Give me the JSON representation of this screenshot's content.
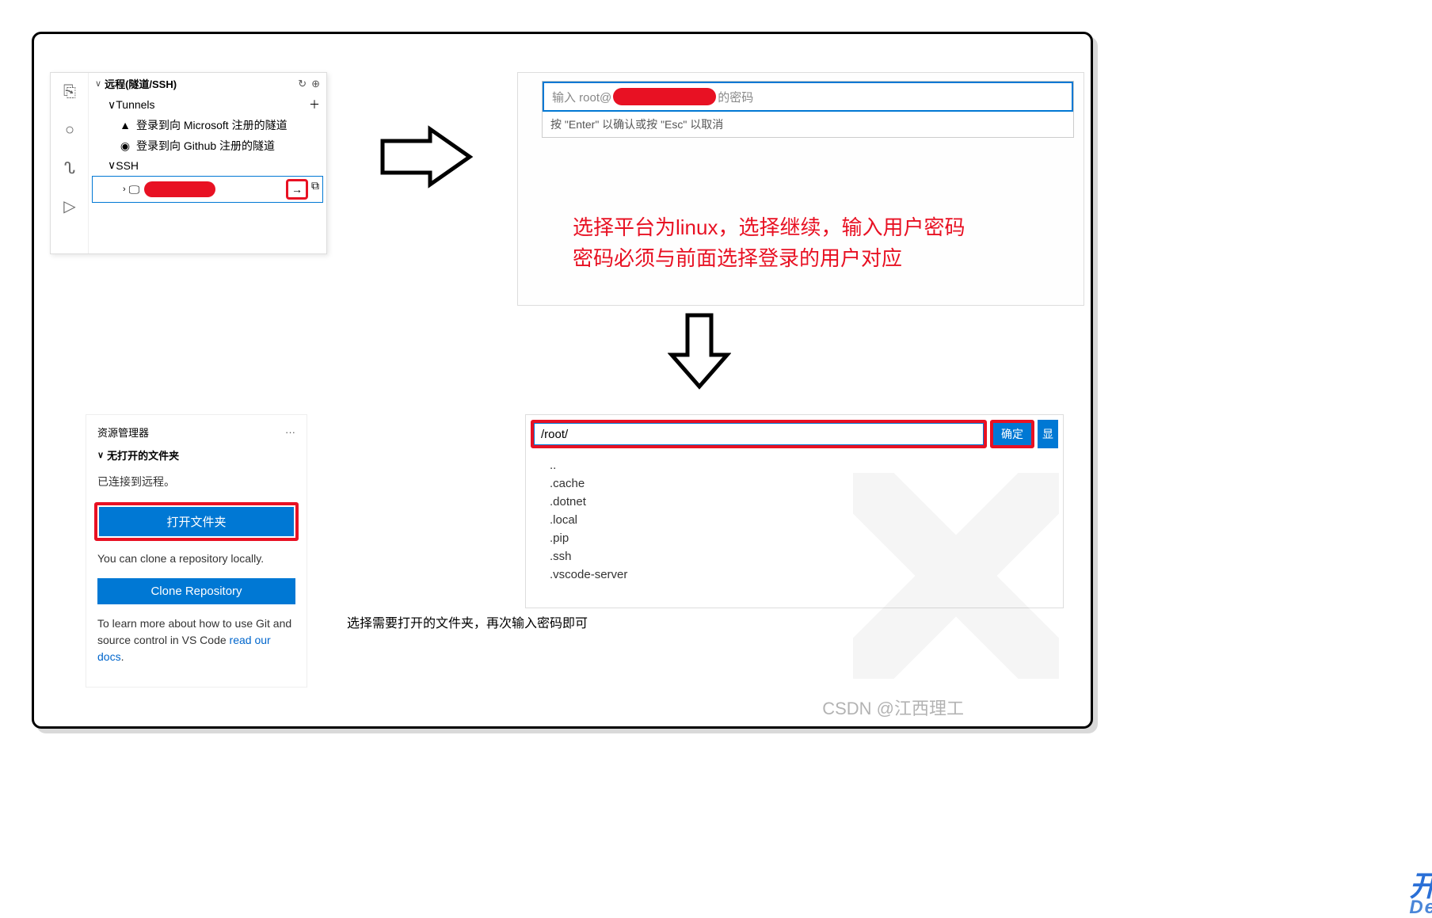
{
  "panel1": {
    "section_title": "远程(隧道/SSH)",
    "tunnels_label": "Tunnels",
    "ms_tunnel": "登录到向 Microsoft 注册的隧道",
    "gh_tunnel": "登录到向 Github 注册的隧道",
    "ssh_label": "SSH",
    "connect_arrow": "→"
  },
  "panel2": {
    "input_prefix": "输入 root@",
    "input_suffix": "的密码",
    "hint": "按 \"Enter\" 以确认或按 \"Esc\" 以取消"
  },
  "annotation": {
    "line1": "选择平台为linux，选择继续，输入用户密码",
    "line2": "密码必须与前面选择登录的用户对应"
  },
  "panel3": {
    "header": "资源管理器",
    "dots": "···",
    "section": "无打开的文件夹",
    "connected": "已连接到远程。",
    "open_folder": "打开文件夹",
    "clone_hint": "You can clone a repository locally.",
    "clone_btn": "Clone Repository",
    "learn_text": "To learn more about how to use Git and source control in VS Code ",
    "learn_link": "read our docs",
    "period": "."
  },
  "panel4": {
    "path": "/root/",
    "confirm": "确定",
    "show": "显",
    "items": [
      "..",
      ".cache",
      ".dotnet",
      ".local",
      ".pip",
      ".ssh",
      ".vscode-server"
    ]
  },
  "caption": "选择需要打开的文件夹，再次输入密码即可",
  "watermark": {
    "csdn": "CSDN @江西理工",
    "devze1": "开 发 者",
    "devze2": "DevZe.CoM"
  }
}
